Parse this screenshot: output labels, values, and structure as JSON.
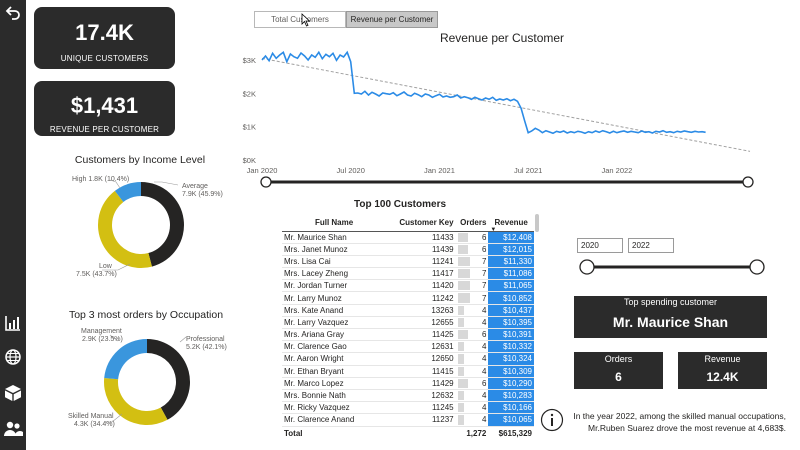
{
  "kpis": {
    "unique_customers": {
      "value": "17.4K",
      "label": "UNIQUE CUSTOMERS"
    },
    "revenue_per_customer": {
      "value": "$1,431",
      "label": "REVENUE PER CUSTOMER"
    }
  },
  "nav_icons": [
    "back-arrow-icon",
    "bar-chart-icon",
    "globe-icon",
    "boxes-icon",
    "people-icon"
  ],
  "tabs": [
    {
      "label": "Total Customers",
      "active": false
    },
    {
      "label": "Revenue per Customer",
      "active": true
    }
  ],
  "income_donut": {
    "title": "Customers by Income Level",
    "labels": {
      "high": "High 1.8K (10.4%)",
      "average_name": "Average",
      "average_value": "7.9K (45.9%)",
      "low_name": "Low",
      "low_value": "7.5K (43.7%)"
    },
    "slices": [
      {
        "name": "Average",
        "value": 45.9,
        "color": "#252423"
      },
      {
        "name": "Low",
        "value": 43.7,
        "color": "#d3bf12"
      },
      {
        "name": "High",
        "value": 10.4,
        "color": "#3a96dd"
      }
    ]
  },
  "occupation_donut": {
    "title": "Top 3 most orders by Occupation",
    "labels": {
      "management_name": "Management",
      "management_value": "2.9K (23.5%)",
      "professional_name": "Professional",
      "professional_value": "5.2K (42.1%)",
      "skilled_name": "Skilled Manual",
      "skilled_value": "4.3K (34.4%)"
    },
    "slices": [
      {
        "name": "Professional",
        "value": 42.1,
        "color": "#252423"
      },
      {
        "name": "Skilled Manual",
        "value": 34.4,
        "color": "#d3bf12"
      },
      {
        "name": "Management",
        "value": 23.5,
        "color": "#3a96dd"
      }
    ]
  },
  "chart_data": {
    "type": "line",
    "title": "Revenue per Customer",
    "y_ticks": [
      "$3K",
      "$2K",
      "$1K",
      "$0K"
    ],
    "y_tick_values": [
      3000,
      2000,
      1000,
      0
    ],
    "ylim": [
      0,
      3300
    ],
    "x_ticks": [
      "Jan 2020",
      "Jul 2020",
      "Jan 2021",
      "Jul 2021",
      "Jan 2022"
    ],
    "x_tick_values": [
      2020.0,
      2020.5,
      2021.0,
      2021.5,
      2022.0
    ],
    "xlim": [
      2020.0,
      2022.75
    ],
    "grid": false,
    "line_color": "#2b8be6",
    "trend_color": "#a0a0a0",
    "x": [
      2020.0,
      2020.02,
      2020.04,
      2020.06,
      2020.08,
      2020.1,
      2020.12,
      2020.14,
      2020.16,
      2020.18,
      2020.2,
      2020.22,
      2020.24,
      2020.26,
      2020.28,
      2020.3,
      2020.32,
      2020.34,
      2020.36,
      2020.38,
      2020.4,
      2020.42,
      2020.44,
      2020.46,
      2020.48,
      2020.5,
      2020.52,
      2020.54,
      2020.56,
      2020.58,
      2020.6,
      2020.62,
      2020.64,
      2020.66,
      2020.68,
      2020.7,
      2020.72,
      2020.74,
      2020.76,
      2020.78,
      2020.8,
      2020.82,
      2020.84,
      2020.86,
      2020.88,
      2020.9,
      2020.92,
      2020.94,
      2020.96,
      2020.98,
      2021.0,
      2021.02,
      2021.04,
      2021.06,
      2021.08,
      2021.1,
      2021.12,
      2021.14,
      2021.16,
      2021.18,
      2021.2,
      2021.22,
      2021.24,
      2021.26,
      2021.28,
      2021.3,
      2021.32,
      2021.34,
      2021.36,
      2021.38,
      2021.4,
      2021.42,
      2021.44,
      2021.46,
      2021.48,
      2021.5,
      2021.52,
      2021.54,
      2021.56,
      2021.58,
      2021.6,
      2021.62,
      2021.64,
      2021.66,
      2021.68,
      2021.7,
      2021.72,
      2021.74,
      2021.76,
      2021.78,
      2021.8,
      2021.82,
      2021.84,
      2021.86,
      2021.88,
      2021.9,
      2021.92,
      2021.94,
      2021.96,
      2021.98,
      2022.0,
      2022.02,
      2022.04,
      2022.06,
      2022.08,
      2022.1,
      2022.12,
      2022.14,
      2022.16,
      2022.18,
      2022.2,
      2022.22,
      2022.24,
      2022.26,
      2022.28,
      2022.3,
      2022.32,
      2022.34,
      2022.36,
      2022.38,
      2022.4,
      2022.42,
      2022.44,
      2022.46,
      2022.48,
      2022.5
    ],
    "y": [
      3000,
      3120,
      2980,
      3200,
      3050,
      3150,
      3230,
      2950,
      3180,
      3100,
      3050,
      3210,
      3120,
      3000,
      3150,
      3080,
      3230,
      3040,
      3170,
      3100,
      3200,
      2990,
      3150,
      3090,
      3230,
      2950,
      2000,
      2010,
      1980,
      2060,
      1950,
      2030,
      1980,
      1920,
      2010,
      1990,
      1970,
      2020,
      1930,
      1980,
      2040,
      1950,
      1920,
      2000,
      1960,
      1900,
      1980,
      1950,
      1880,
      1930,
      1970,
      1890,
      1920,
      1880,
      1900,
      1950,
      1860,
      1900,
      1870,
      1820,
      1880,
      1840,
      1800,
      1860,
      1820,
      1880,
      1790,
      1830,
      1800,
      1840,
      1780,
      1820,
      1760,
      1550,
      1180,
      820,
      870,
      950,
      900,
      820,
      880,
      840,
      800,
      860,
      830,
      870,
      810,
      850,
      820,
      860,
      840,
      800,
      850,
      820,
      870,
      830,
      880,
      850,
      810,
      860,
      820,
      850,
      870,
      830,
      860,
      840,
      820,
      870,
      830,
      850,
      810,
      860,
      840,
      880,
      830,
      850,
      820,
      860,
      840,
      870,
      850,
      830,
      860,
      840,
      850,
      830
    ],
    "trend": {
      "y_start": 3050,
      "y_end": 260
    }
  },
  "sliders": {
    "chart_range": {
      "start": 0,
      "end": 1
    },
    "year_range": {
      "start": 0,
      "end": 1,
      "from": "2020",
      "to": "2022"
    }
  },
  "table": {
    "title": "Top 100 Customers",
    "columns": [
      "Full Name",
      "Customer Key",
      "Orders",
      "Revenue"
    ],
    "rows": [
      {
        "name": "Mr. Maurice Shan",
        "key": "11433",
        "orders": 6,
        "revenue": "$12,408"
      },
      {
        "name": "Mrs. Janet Munoz",
        "key": "11439",
        "orders": 6,
        "revenue": "$12,015"
      },
      {
        "name": "Mrs. Lisa Cai",
        "key": "11241",
        "orders": 7,
        "revenue": "$11,330"
      },
      {
        "name": "Mrs. Lacey Zheng",
        "key": "11417",
        "orders": 7,
        "revenue": "$11,086"
      },
      {
        "name": "Mr. Jordan Turner",
        "key": "11420",
        "orders": 7,
        "revenue": "$11,065"
      },
      {
        "name": "Mr. Larry Munoz",
        "key": "11242",
        "orders": 7,
        "revenue": "$10,852"
      },
      {
        "name": "Mrs. Kate Anand",
        "key": "13263",
        "orders": 4,
        "revenue": "$10,437"
      },
      {
        "name": "Mr. Larry Vazquez",
        "key": "12655",
        "orders": 4,
        "revenue": "$10,395"
      },
      {
        "name": "Mrs. Ariana Gray",
        "key": "11425",
        "orders": 6,
        "revenue": "$10,391"
      },
      {
        "name": "Mr. Clarence Gao",
        "key": "12631",
        "orders": 4,
        "revenue": "$10,332"
      },
      {
        "name": "Mr. Aaron Wright",
        "key": "12650",
        "orders": 4,
        "revenue": "$10,324"
      },
      {
        "name": "Mr. Ethan Bryant",
        "key": "11415",
        "orders": 4,
        "revenue": "$10,309"
      },
      {
        "name": "Mr. Marco Lopez",
        "key": "11429",
        "orders": 6,
        "revenue": "$10,290"
      },
      {
        "name": "Mrs. Bonnie Nath",
        "key": "12632",
        "orders": 4,
        "revenue": "$10,283"
      },
      {
        "name": "Mr. Ricky Vazquez",
        "key": "11245",
        "orders": 4,
        "revenue": "$10,166"
      },
      {
        "name": "Mr. Clarence Anand",
        "key": "11237",
        "orders": 4,
        "revenue": "$10,065"
      }
    ],
    "total": {
      "label": "Total",
      "orders": "1,272",
      "revenue": "$615,329"
    }
  },
  "top_customer": {
    "heading": "Top spending customer",
    "name": "Mr. Maurice Shan",
    "orders_label": "Orders",
    "orders_value": "6",
    "revenue_label": "Revenue",
    "revenue_value": "12.4K"
  },
  "insight": {
    "line1": "In the year 2022, among the skilled manual occupations,",
    "line2": "Mr.Ruben Suarez drove the most revenue at 4,683$."
  }
}
